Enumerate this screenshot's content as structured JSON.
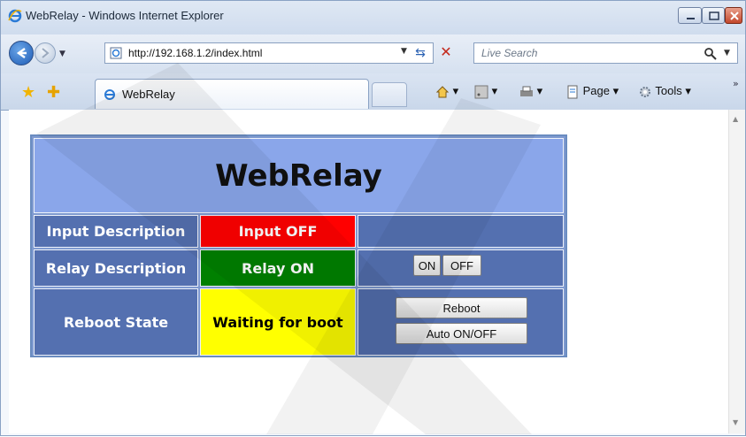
{
  "window": {
    "title": "WebRelay - Windows Internet Explorer"
  },
  "navigation": {
    "address": "http://192.168.1.2/index.html",
    "search_placeholder": "Live Search"
  },
  "tabs": [
    {
      "label": "WebRelay"
    }
  ],
  "command_bar": {
    "page_label": "Page",
    "tools_label": "Tools"
  },
  "page": {
    "heading": "WebRelay",
    "rows": [
      {
        "label": "Input Description",
        "status": "Input OFF",
        "status_color": "#ff0000",
        "status_text_color": "#ffffff"
      },
      {
        "label": "Relay Description",
        "status": "Relay ON",
        "status_color": "#008000",
        "status_text_color": "#ffffff",
        "buttons": [
          "ON",
          "OFF"
        ]
      },
      {
        "label": "Reboot State",
        "status": "Waiting for boot",
        "status_color": "#ffff00",
        "status_text_color": "#000000",
        "buttons": [
          "Reboot",
          "Auto ON/OFF"
        ]
      }
    ]
  },
  "colors": {
    "header_bg": "#8aa6ea",
    "label_bg": "#5470b0"
  }
}
